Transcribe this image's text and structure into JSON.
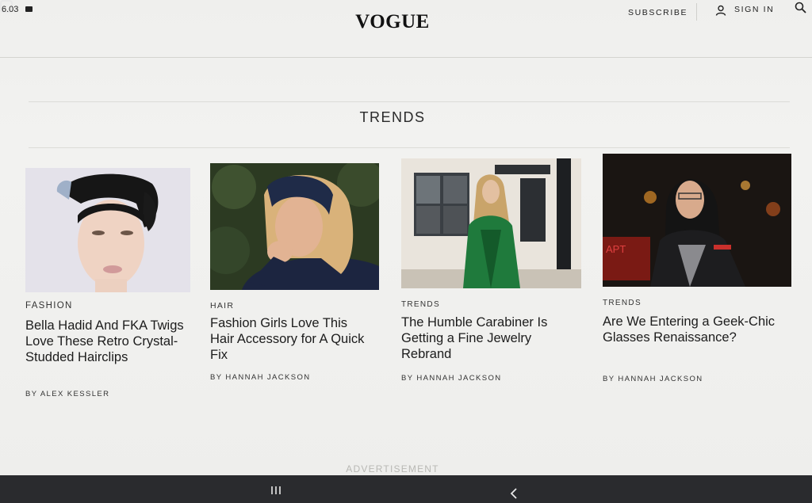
{
  "status": {
    "time": "6.03"
  },
  "header": {
    "logo": "VOGUE",
    "subscribe": "SUBSCRIBE",
    "sign_in": "SIGN IN"
  },
  "section": {
    "title": "TRENDS"
  },
  "cards": [
    {
      "category": "FASHION",
      "headline": "Bella Hadid And FKA Twigs Love These Retro Crystal-Studded Hairclips",
      "byline": "BY ALEX KESSLER",
      "image_desc": "portrait with slicked-back dark hair"
    },
    {
      "category": "HAIR",
      "headline": "Fashion Girls Love This Hair Accessory for A Quick Fix",
      "byline": "BY HANNAH JACKSON",
      "image_desc": "blonde woman with navy headband"
    },
    {
      "category": "TRENDS",
      "headline": "The Humble Carabiner Is Getting a Fine Jewelry Rebrand",
      "byline": "BY HANNAH JACKSON",
      "image_desc": "woman in green leather jacket on street"
    },
    {
      "category": "TRENDS",
      "headline": "Are We Entering a Geek-Chic Glasses Renaissance?",
      "byline": "BY HANNAH JACKSON",
      "image_desc": "woman with glasses at night"
    }
  ],
  "ad_label": "ADVERTISEMENT",
  "icons": {
    "user": "user-icon",
    "search": "search-icon",
    "recent_apps": "recent-apps-icon",
    "home": "home-icon",
    "back": "back-icon"
  },
  "colors": {
    "background": "#efefed",
    "text": "#1c1c1c",
    "navbar": "#2a2b2e"
  }
}
